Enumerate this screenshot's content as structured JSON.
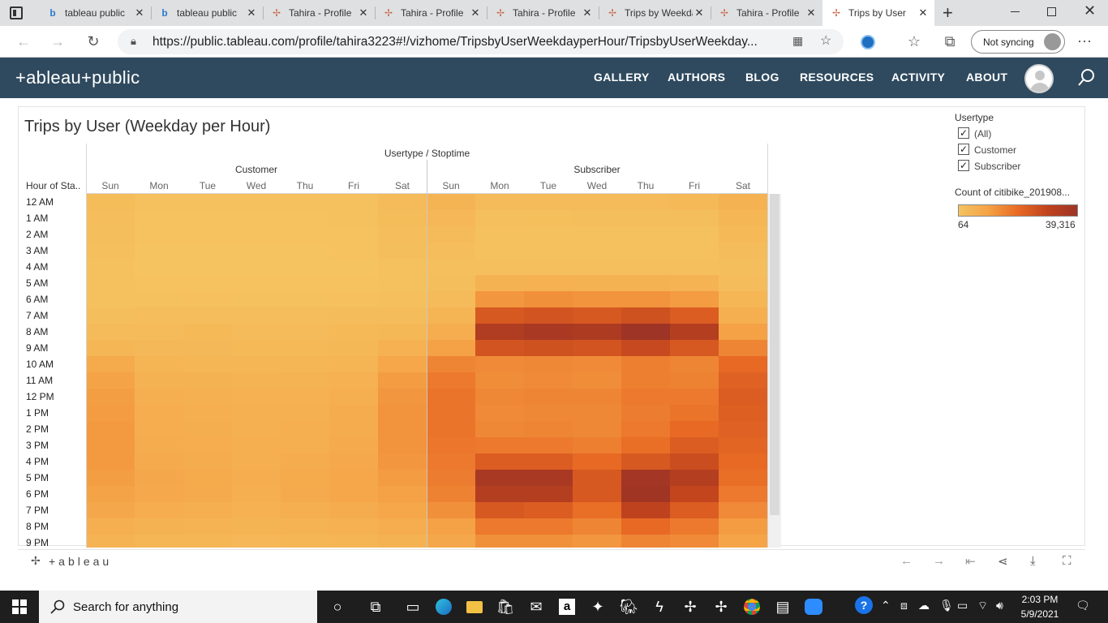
{
  "browser": {
    "tabs": [
      {
        "title": "tableau public",
        "icon": "bing-icon",
        "active": false
      },
      {
        "title": "tableau public",
        "icon": "bing-icon",
        "active": false
      },
      {
        "title": "Tahira - Profile",
        "icon": "tableau-icon",
        "active": false
      },
      {
        "title": "Tahira - Profile",
        "icon": "tableau-icon",
        "active": false
      },
      {
        "title": "Tahira - Profile",
        "icon": "tableau-icon",
        "active": false
      },
      {
        "title": "Trips by Weekday",
        "icon": "tableau-icon",
        "active": false
      },
      {
        "title": "Tahira - Profile",
        "icon": "tableau-icon",
        "active": false
      },
      {
        "title": "Trips by User",
        "icon": "tableau-icon",
        "active": true
      }
    ],
    "url": "https://public.tableau.com/profile/tahira3223#!/vizhome/TripsbyUserWeekdayperHour/TripsbyUserWeekday...",
    "sync_label": "Not syncing"
  },
  "site": {
    "logo": "+ableau+public",
    "nav": [
      "GALLERY",
      "AUTHORS",
      "BLOG",
      "RESOURCES",
      "ACTIVITY",
      "ABOUT"
    ]
  },
  "viz": {
    "title": "Trips by User (Weekday per Hour)",
    "column_header": "Usertype / Stoptime",
    "row_header": "Hour of Sta..",
    "groups": [
      "Customer",
      "Subscriber"
    ],
    "days": [
      "Sun",
      "Mon",
      "Tue",
      "Wed",
      "Thu",
      "Fri",
      "Sat",
      "Sun",
      "Mon",
      "Tue",
      "Wed",
      "Thu",
      "Fri",
      "Sat"
    ],
    "hours": [
      "12 AM",
      "1 AM",
      "2 AM",
      "3 AM",
      "4 AM",
      "5 AM",
      "6 AM",
      "7 AM",
      "8 AM",
      "9 AM",
      "10 AM",
      "11 AM",
      "12 PM",
      "1 PM",
      "2 PM",
      "3 PM",
      "4 PM",
      "5 PM",
      "6 PM",
      "7 PM",
      "8 PM",
      "9 PM"
    ]
  },
  "filter": {
    "title": "Usertype",
    "options": [
      {
        "label": "(All)",
        "checked": true
      },
      {
        "label": "Customer",
        "checked": true
      },
      {
        "label": "Subscriber",
        "checked": true
      }
    ]
  },
  "legend": {
    "title": "Count of citibike_201908...",
    "min_label": "64",
    "max_label": "39,316",
    "colors": [
      "#f5c360",
      "#f5a246",
      "#e86a24",
      "#c0431e",
      "#9e3425"
    ]
  },
  "toolbar": {
    "logo": "+ableau"
  },
  "taskbar": {
    "search_placeholder": "Search for anything",
    "time": "2:03 PM",
    "date": "5/9/2021"
  },
  "chart_data": {
    "type": "heatmap",
    "title": "Trips by User (Weekday per Hour)",
    "x_header": "Usertype / Stoptime",
    "y_header": "Hour of Sta..",
    "x_groups": [
      "Customer",
      "Subscriber"
    ],
    "x": [
      "Sun",
      "Mon",
      "Tue",
      "Wed",
      "Thu",
      "Fri",
      "Sat"
    ],
    "y": [
      "12 AM",
      "1 AM",
      "2 AM",
      "3 AM",
      "4 AM",
      "5 AM",
      "6 AM",
      "7 AM",
      "8 AM",
      "9 AM",
      "10 AM",
      "11 AM",
      "12 PM",
      "1 PM",
      "2 PM",
      "3 PM",
      "4 PM",
      "5 PM",
      "6 PM",
      "7 PM",
      "8 PM",
      "9 PM"
    ],
    "value_label": "Count of citibike_201908...",
    "value_range": [
      64,
      39316
    ],
    "series": [
      {
        "name": "Customer",
        "values": [
          [
            2200,
            800,
            600,
            700,
            800,
            1000,
            2800
          ],
          [
            1800,
            500,
            400,
            500,
            500,
            700,
            2200
          ],
          [
            1500,
            300,
            300,
            300,
            300,
            400,
            1800
          ],
          [
            1200,
            200,
            200,
            200,
            200,
            300,
            1500
          ],
          [
            800,
            200,
            200,
            200,
            200,
            200,
            1000
          ],
          [
            700,
            300,
            300,
            300,
            300,
            300,
            800
          ],
          [
            1000,
            1000,
            1100,
            1000,
            1000,
            1100,
            1300
          ],
          [
            1500,
            1800,
            1900,
            1800,
            1800,
            2000,
            2000
          ],
          [
            2500,
            2800,
            3000,
            2800,
            2800,
            3000,
            3300
          ],
          [
            4000,
            3200,
            3200,
            3000,
            3000,
            3400,
            5500
          ],
          [
            7500,
            4200,
            4000,
            3800,
            3800,
            4200,
            8500
          ],
          [
            9500,
            5200,
            5000,
            4700,
            4800,
            5300,
            11000
          ],
          [
            10500,
            6000,
            5800,
            5400,
            5500,
            6200,
            12000
          ],
          [
            11000,
            6500,
            6200,
            5700,
            5800,
            6800,
            12500
          ],
          [
            11500,
            6500,
            6300,
            5800,
            6000,
            7000,
            12500
          ],
          [
            11500,
            6800,
            6500,
            6000,
            6200,
            7300,
            12500
          ],
          [
            11200,
            7200,
            7000,
            6200,
            6800,
            7800,
            12000
          ],
          [
            10500,
            8000,
            7500,
            6500,
            7500,
            8500,
            11000
          ],
          [
            9500,
            7800,
            7300,
            6200,
            7300,
            8300,
            10000
          ],
          [
            8000,
            6500,
            6200,
            5500,
            6000,
            7000,
            8500
          ],
          [
            6000,
            5000,
            4800,
            4500,
            4800,
            5300,
            6500
          ],
          [
            4800,
            4000,
            3800,
            3500,
            3800,
            4200,
            5000
          ]
        ]
      },
      {
        "name": "Subscriber",
        "values": [
          [
            4500,
            2500,
            2600,
            2700,
            2800,
            3000,
            5000
          ],
          [
            3500,
            1300,
            1400,
            1500,
            1500,
            1600,
            4000
          ],
          [
            2700,
            800,
            800,
            900,
            900,
            1000,
            3000
          ],
          [
            1800,
            600,
            600,
            600,
            600,
            700,
            2000
          ],
          [
            1300,
            1200,
            1200,
            1200,
            1200,
            1200,
            1500
          ],
          [
            1500,
            5000,
            5300,
            5200,
            5200,
            4700,
            2000
          ],
          [
            2700,
            12000,
            13000,
            12500,
            12500,
            11000,
            3800
          ],
          [
            4200,
            24000,
            25000,
            24000,
            26000,
            23000,
            6000
          ],
          [
            6500,
            34000,
            36000,
            35000,
            39316,
            33000,
            10000
          ],
          [
            10000,
            25000,
            26000,
            25000,
            28000,
            24000,
            15000
          ],
          [
            15000,
            14000,
            14500,
            14000,
            16000,
            15000,
            20000
          ],
          [
            17000,
            13500,
            14000,
            13500,
            16000,
            15500,
            22000
          ],
          [
            18000,
            14500,
            15000,
            15000,
            17000,
            17000,
            23000
          ],
          [
            18000,
            14000,
            14500,
            14500,
            16500,
            18000,
            22500
          ],
          [
            18000,
            14500,
            15000,
            14500,
            17000,
            20000,
            22000
          ],
          [
            17500,
            17000,
            17000,
            16000,
            19000,
            23000,
            21000
          ],
          [
            17000,
            23000,
            23000,
            20000,
            24000,
            27000,
            20000
          ],
          [
            16500,
            36000,
            36000,
            24000,
            38000,
            33000,
            19000
          ],
          [
            15500,
            33000,
            33000,
            24000,
            38500,
            29000,
            17000
          ],
          [
            13000,
            24000,
            23000,
            19000,
            30000,
            23000,
            14000
          ],
          [
            10000,
            17000,
            17000,
            15000,
            20000,
            17000,
            11000
          ],
          [
            8000,
            13000,
            13000,
            12000,
            15000,
            14000,
            9000
          ]
        ]
      }
    ]
  }
}
